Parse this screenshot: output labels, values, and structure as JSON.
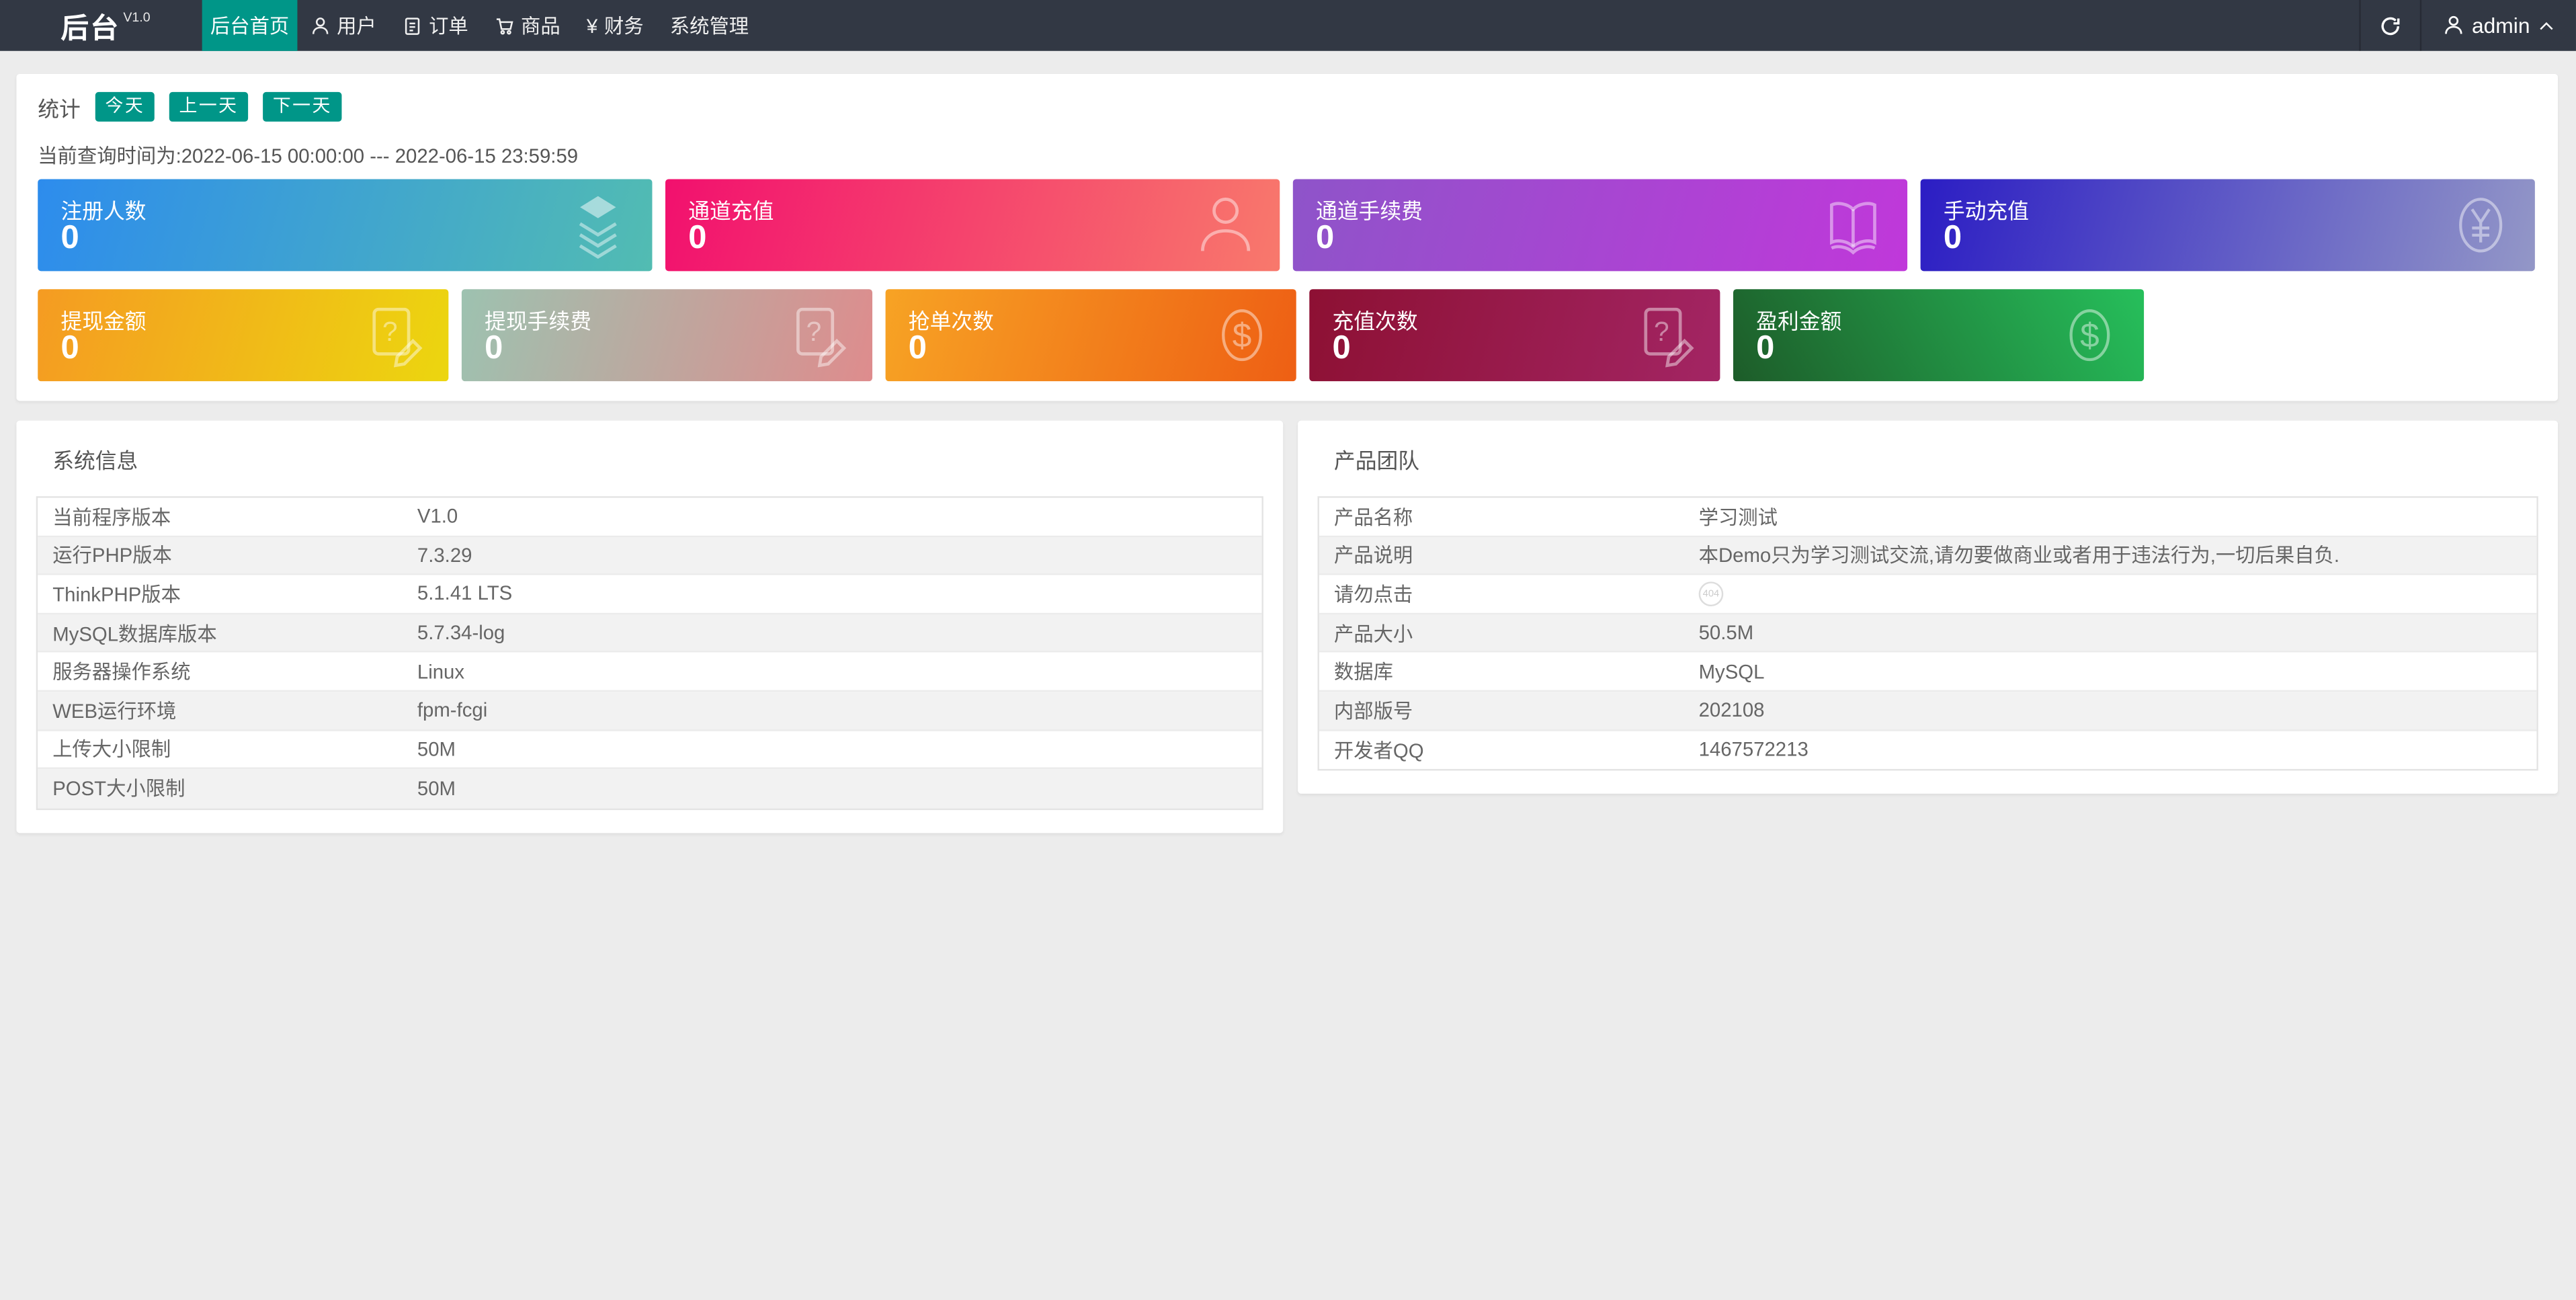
{
  "theme": {
    "navbar_bg": "#323844",
    "accent": "#009688",
    "page_bg": "#ececec",
    "table_stripe": "#f2f2f2"
  },
  "navbar": {
    "brand": "后台",
    "version": "V1.0",
    "menu": [
      {
        "label": "后台首页",
        "active": true,
        "icon": "none"
      },
      {
        "label": "用户",
        "active": false,
        "icon": "user-icon"
      },
      {
        "label": "订单",
        "active": false,
        "icon": "document-icon"
      },
      {
        "label": "商品",
        "active": false,
        "icon": "cart-icon"
      },
      {
        "label": "财务",
        "active": false,
        "icon": "yen-icon",
        "yen": "¥"
      },
      {
        "label": "系统管理",
        "active": false,
        "icon": "none"
      }
    ],
    "username": "admin"
  },
  "stats": {
    "section_label": "统计",
    "buttons": [
      {
        "label": "今天"
      },
      {
        "label": "上一天"
      },
      {
        "label": "下一天"
      }
    ],
    "query_time": "当前查询时间为:2022-06-15 00:00:00 --- 2022-06-15 23:59:59",
    "row1": [
      {
        "title": "注册人数",
        "value": "0",
        "icon": "layers-icon",
        "gradient": [
          "#2d8ced",
          "#52bcb2"
        ]
      },
      {
        "title": "通道充值",
        "value": "0",
        "icon": "user-icon",
        "gradient": [
          "#f2106e",
          "#f8796c"
        ]
      },
      {
        "title": "通道手续费",
        "value": "0",
        "icon": "book-icon",
        "gradient": [
          "#8e54c9",
          "#c038da"
        ]
      },
      {
        "title": "手动充值",
        "value": "0",
        "icon": "yen-circle-icon",
        "gradient": [
          "#2b1dc4",
          "#9397c7"
        ]
      }
    ],
    "row2": [
      {
        "title": "提现金额",
        "value": "0",
        "icon": "doc-question-icon",
        "gradient": [
          "#f59b22",
          "#ecd60f"
        ]
      },
      {
        "title": "提现手续费",
        "value": "0",
        "icon": "doc-question-icon",
        "gradient": [
          "#9dc2b0",
          "#de8c8d"
        ]
      },
      {
        "title": "抢单次数",
        "value": "0",
        "icon": "dollar-circle-icon",
        "gradient": [
          "#f7a324",
          "#ee5f14"
        ]
      },
      {
        "title": "充值次数",
        "value": "0",
        "icon": "doc-question-icon",
        "gradient": [
          "#8d1033",
          "#a32564"
        ]
      },
      {
        "title": "盈利金额",
        "value": "0",
        "icon": "dollar-circle-icon",
        "gradient": [
          "#1d5c29",
          "#26bf5b"
        ]
      }
    ]
  },
  "system_info": {
    "title": "系统信息",
    "rows": [
      {
        "label": "当前程序版本",
        "value": "V1.0"
      },
      {
        "label": "运行PHP版本",
        "value": "7.3.29"
      },
      {
        "label": "ThinkPHP版本",
        "value": "5.1.41 LTS"
      },
      {
        "label": "MySQL数据库版本",
        "value": "5.7.34-log"
      },
      {
        "label": "服务器操作系统",
        "value": "Linux"
      },
      {
        "label": "WEB运行环境",
        "value": "fpm-fcgi"
      },
      {
        "label": "上传大小限制",
        "value": "50M"
      },
      {
        "label": "POST大小限制",
        "value": "50M"
      }
    ]
  },
  "product_team": {
    "title": "产品团队",
    "rows": [
      {
        "label": "产品名称",
        "value": "学习测试"
      },
      {
        "label": "产品说明",
        "value": "本Demo只为学习测试交流,请勿要做商业或者用于违法行为,一切后果自负."
      },
      {
        "label": "请勿点击",
        "value": "404"
      },
      {
        "label": "产品大小",
        "value": "50.5M"
      },
      {
        "label": "数据库",
        "value": "MySQL"
      },
      {
        "label": "内部版号",
        "value": "202108"
      },
      {
        "label": "开发者QQ",
        "value": "1467572213"
      }
    ]
  }
}
